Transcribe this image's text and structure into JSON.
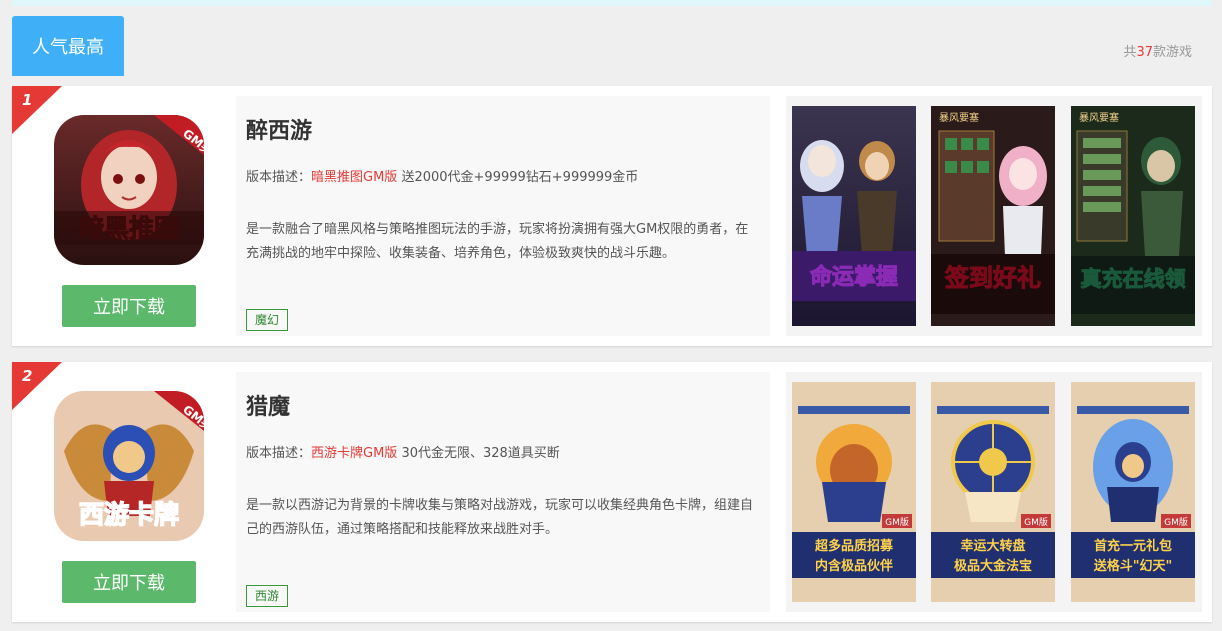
{
  "header": {
    "tab_label": "人气最高",
    "count_prefix": "共",
    "count_value": "37",
    "count_suffix": "款游戏"
  },
  "colors": {
    "tab": "#3fb0f7",
    "download": "#5cb86b",
    "rank_badge": "#e53935",
    "highlight": "#e53935",
    "tag": "#2f8a2f"
  },
  "games": [
    {
      "rank": "1",
      "name": "醉西游",
      "icon": "gm-dark-hero-game-icon",
      "icon_badge": "GM买断",
      "icon_text": "暗黑推图",
      "download_label": "立即下载",
      "version_label": "版本描述：",
      "version_name": "暗黑推图GM版",
      "version_extra": " 送2000代金+99999钻石+999999金币",
      "description": "是一款融合了暗黑风格与策略推图玩法的手游，玩家将扮演拥有强大GM权限的勇者，在充满挑战的地牢中探险、收集装备、培养角色，体验极致爽快的战斗乐趣。",
      "tag": "魔幻",
      "screenshots": [
        {
          "caption": "命运掌握",
          "icon": "screenshot-heroes"
        },
        {
          "header": "暴风要塞",
          "caption": "签到好礼",
          "icon": "screenshot-signin"
        },
        {
          "header": "暴风要塞",
          "caption": "真充在线领",
          "icon": "screenshot-recharge"
        }
      ]
    },
    {
      "rank": "2",
      "name": "猎魔",
      "icon": "gm-westward-card-game-icon",
      "icon_badge": "GM买断",
      "icon_text": "西游卡牌",
      "download_label": "立即下载",
      "version_label": "版本描述：",
      "version_name": "西游卡牌GM版",
      "version_extra": " 30代金无限、328道具买断",
      "description": "是一款以西游记为背景的卡牌收集与策略对战游戏，玩家可以收集经典角色卡牌，组建自己的西游队伍，通过策略搭配和技能释放来战胜对手。",
      "tag": "西游",
      "screenshots": [
        {
          "caption_line1": "超多品质招募",
          "caption_line2": "内含极品伙伴",
          "badge": "GM版",
          "icon": "screenshot-recruit"
        },
        {
          "caption_line1": "幸运大转盘",
          "caption_line2": "极品大金法宝",
          "badge": "GM版",
          "icon": "screenshot-wheel"
        },
        {
          "caption_line1": "首充一元礼包",
          "caption_line2": "送格斗\"幻天\"",
          "badge": "GM版",
          "icon": "screenshot-firstpay"
        }
      ]
    }
  ]
}
